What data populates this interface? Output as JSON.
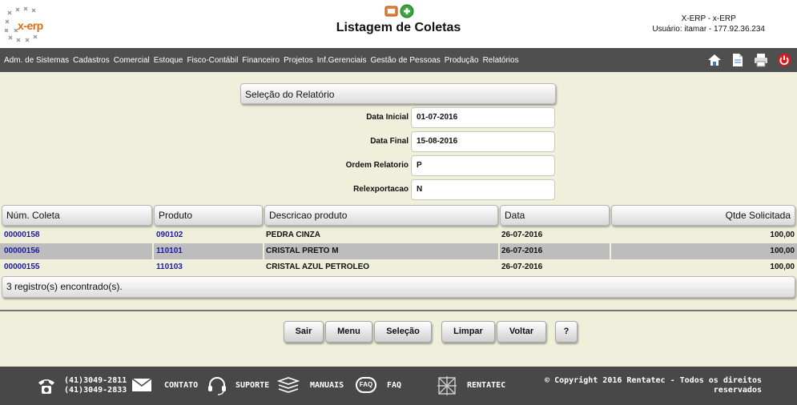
{
  "logo": {
    "text": "x-erp"
  },
  "header": {
    "title": "Listagem de Coletas",
    "company": "X-ERP - x-ERP",
    "user": "Usuário: itamar - 177.92.36.234"
  },
  "menu": {
    "items": [
      "Adm. de Sistemas",
      "Cadastros",
      "Comercial",
      "Estoque",
      "Fisco-Contábil",
      "Financeiro",
      "Projetos",
      "Inf.Gerenciais",
      "Gestão de Pessoas",
      "Produção",
      "Relatórios"
    ]
  },
  "tools": [
    "home-icon",
    "document-icon",
    "printer-icon",
    "power-icon"
  ],
  "report": {
    "title": "Seleção do Relatório",
    "fields": [
      {
        "label": "Data Inicial",
        "value": "01-07-2016"
      },
      {
        "label": "Data Final",
        "value": "15-08-2016"
      },
      {
        "label": "Ordem Relatorio",
        "value": "P"
      },
      {
        "label": "Relexportacao",
        "value": "N"
      }
    ]
  },
  "table": {
    "columns": [
      "Núm. Coleta",
      "Produto",
      "Descricao produto",
      "Data",
      "Qtde Solicitada"
    ],
    "rows": [
      {
        "coleta": "00000158",
        "produto": "090102",
        "descricao": "PEDRA CINZA",
        "data": "26-07-2016",
        "qtde": "100,00"
      },
      {
        "coleta": "00000156",
        "produto": "110101",
        "descricao": "CRISTAL PRETO M",
        "data": "26-07-2016",
        "qtde": "100,00"
      },
      {
        "coleta": "00000155",
        "produto": "110103",
        "descricao": "CRISTAL AZUL PETROLEO",
        "data": "26-07-2016",
        "qtde": "100,00"
      }
    ],
    "count_text": "3 registro(s) encontrado(s)."
  },
  "buttons": {
    "sair": "Sair",
    "menu": "Menu",
    "selecao": "Seleção",
    "limpar": "Limpar",
    "voltar": "Voltar",
    "help": "?"
  },
  "bottom": {
    "phone1": "(41)3049-2811",
    "phone2": "(41)3049-2833",
    "contato": "CONTATO",
    "suporte": "SUPORTE",
    "manuais": "MANUAIS",
    "faq_badge": "FAQ",
    "faq": "FAQ",
    "rentatec": "RENTATEC",
    "copyright1": "© Copyright 2016 Rentatec - Todos os direitos",
    "copyright2": "reservados"
  },
  "colors": {
    "background": "#efefdc",
    "menubar": "#4f4f4f",
    "link": "#1a1aa6",
    "accent": "#e06a10"
  }
}
